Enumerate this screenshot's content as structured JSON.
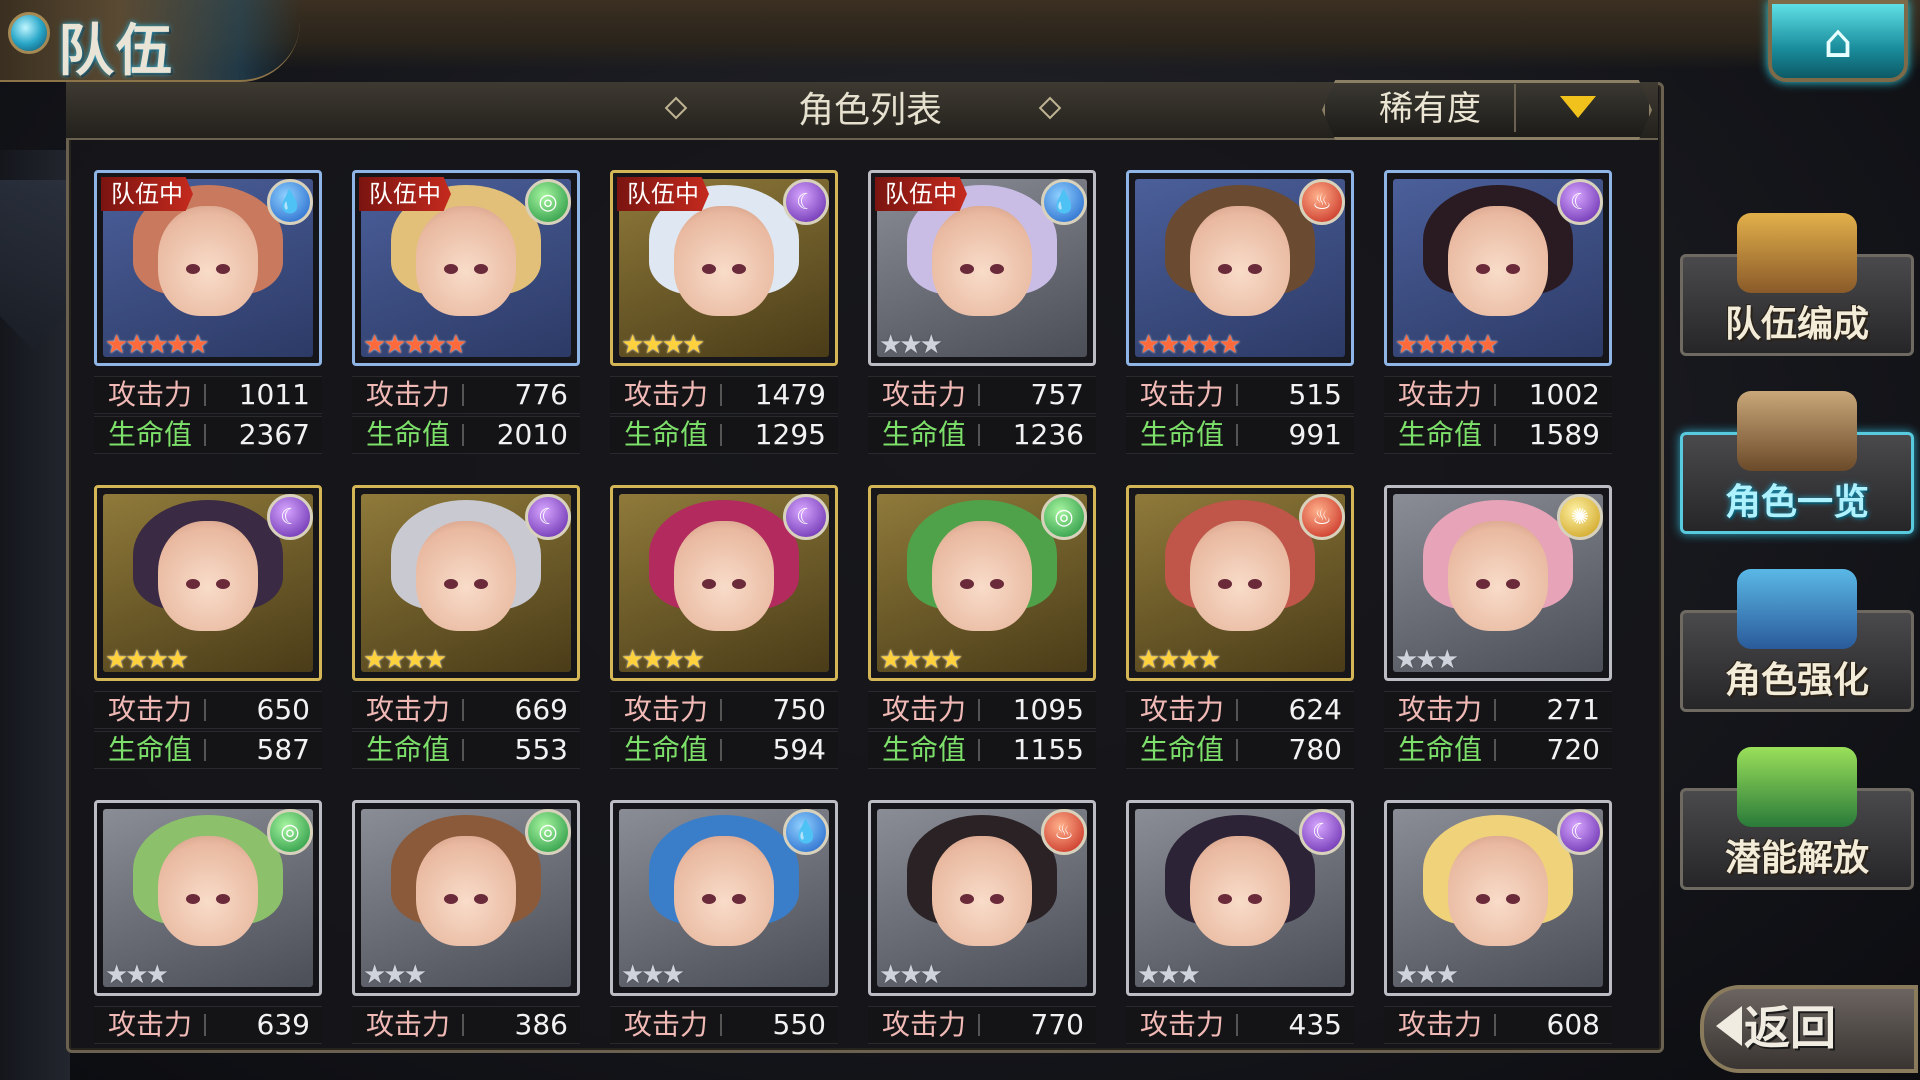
{
  "header": {
    "title": "队伍"
  },
  "list_panel": {
    "title": "角色列表",
    "sort_label": "稀有度"
  },
  "card_labels": {
    "attack": "攻击力",
    "hp": "生命值",
    "team_tag": "队伍中"
  },
  "characters": [
    {
      "in_team": true,
      "element": "water",
      "rarity": 5,
      "frame": "blue",
      "attack": "1011",
      "hp": "2367"
    },
    {
      "in_team": true,
      "element": "wind",
      "rarity": 5,
      "frame": "blue",
      "attack": "776",
      "hp": "2010"
    },
    {
      "in_team": true,
      "element": "dark",
      "rarity": 4,
      "frame": "gold",
      "attack": "1479",
      "hp": "1295"
    },
    {
      "in_team": true,
      "element": "water",
      "rarity": 3,
      "frame": "silver",
      "attack": "757",
      "hp": "1236"
    },
    {
      "in_team": false,
      "element": "fire",
      "rarity": 5,
      "frame": "blue",
      "attack": "515",
      "hp": "991"
    },
    {
      "in_team": false,
      "element": "dark",
      "rarity": 5,
      "frame": "blue",
      "attack": "1002",
      "hp": "1589"
    },
    {
      "in_team": false,
      "element": "dark",
      "rarity": 4,
      "frame": "gold",
      "attack": "650",
      "hp": "587"
    },
    {
      "in_team": false,
      "element": "dark",
      "rarity": 4,
      "frame": "gold",
      "attack": "669",
      "hp": "553"
    },
    {
      "in_team": false,
      "element": "dark",
      "rarity": 4,
      "frame": "gold",
      "attack": "750",
      "hp": "594"
    },
    {
      "in_team": false,
      "element": "wind",
      "rarity": 4,
      "frame": "gold",
      "attack": "1095",
      "hp": "1155"
    },
    {
      "in_team": false,
      "element": "fire",
      "rarity": 4,
      "frame": "gold",
      "attack": "624",
      "hp": "780"
    },
    {
      "in_team": false,
      "element": "light",
      "rarity": 3,
      "frame": "silver",
      "attack": "271",
      "hp": "720"
    },
    {
      "in_team": false,
      "element": "wind",
      "rarity": 3,
      "frame": "silver",
      "attack": "639",
      "hp": ""
    },
    {
      "in_team": false,
      "element": "wind",
      "rarity": 3,
      "frame": "silver",
      "attack": "386",
      "hp": ""
    },
    {
      "in_team": false,
      "element": "water",
      "rarity": 3,
      "frame": "silver",
      "attack": "550",
      "hp": ""
    },
    {
      "in_team": false,
      "element": "fire",
      "rarity": 3,
      "frame": "silver",
      "attack": "770",
      "hp": ""
    },
    {
      "in_team": false,
      "element": "dark",
      "rarity": 3,
      "frame": "silver",
      "attack": "435",
      "hp": ""
    },
    {
      "in_team": false,
      "element": "dark",
      "rarity": 3,
      "frame": "silver",
      "attack": "608",
      "hp": ""
    }
  ],
  "side_menu": [
    {
      "label": "队伍编成",
      "active": false
    },
    {
      "label": "角色一览",
      "active": true
    },
    {
      "label": "角色强化",
      "active": false
    },
    {
      "label": "潜能解放",
      "active": false
    }
  ],
  "back_label": "返回",
  "colors": {
    "accent_blue": "#59c9de",
    "team_tag_red": "#c52a1e",
    "hp_green": "#7de06a",
    "sort_arrow": "#f2c21c"
  }
}
